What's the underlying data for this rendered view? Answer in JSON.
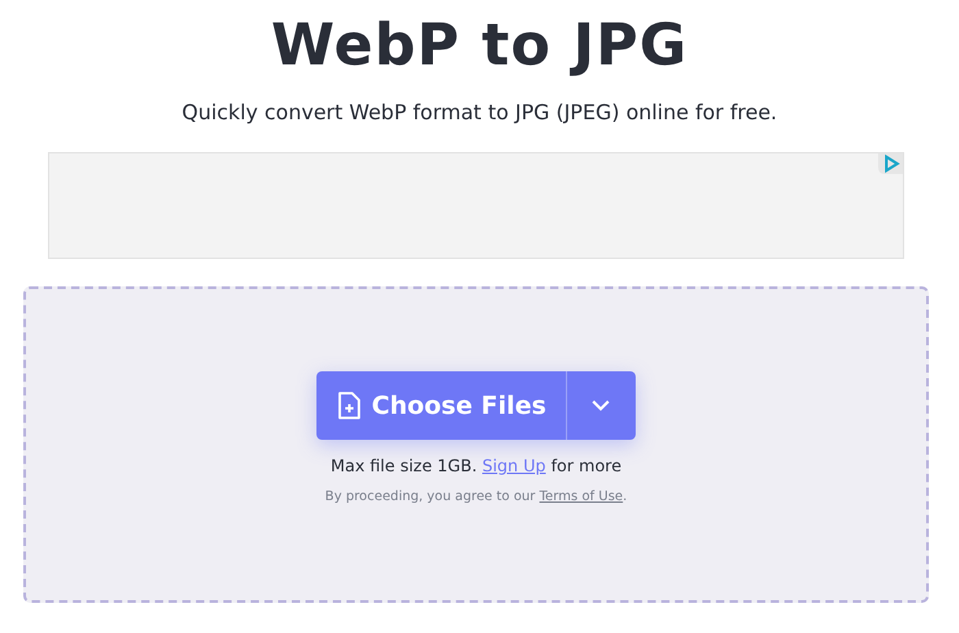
{
  "header": {
    "title": "WebP to JPG",
    "subtitle": "Quickly convert WebP format to JPG (JPEG) online for free."
  },
  "ad_banner": {
    "kind": "ad"
  },
  "upload": {
    "button": "Choose Files",
    "limit": {
      "before": "Max file size 1GB.",
      "link": "Sign Up",
      "after": "for more"
    },
    "terms": {
      "before": "By proceeding, you agree to our",
      "link": "Terms of Use",
      "after": "."
    }
  }
}
